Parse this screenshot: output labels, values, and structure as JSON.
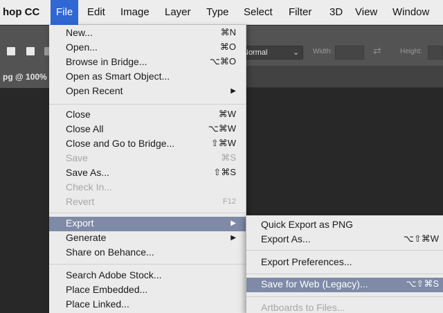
{
  "menubar": {
    "app_name": "hop CC",
    "items": [
      "File",
      "Edit",
      "Image",
      "Layer",
      "Type",
      "Select",
      "Filter",
      "3D",
      "View",
      "Window"
    ]
  },
  "options_bar": {
    "style_value": "Normal",
    "width_label": "Width:",
    "height_label": "Height:"
  },
  "document_tab": {
    "label": "pg @ 100%"
  },
  "file_menu": {
    "new": {
      "label": "New...",
      "shortcut": "⌘N"
    },
    "open": {
      "label": "Open...",
      "shortcut": "⌘O"
    },
    "browse_bridge": {
      "label": "Browse in Bridge...",
      "shortcut": "⌥⌘O"
    },
    "open_smart_object": {
      "label": "Open as Smart Object..."
    },
    "open_recent": {
      "label": "Open Recent",
      "arrow": "▶"
    },
    "close": {
      "label": "Close",
      "shortcut": "⌘W"
    },
    "close_all": {
      "label": "Close All",
      "shortcut": "⌥⌘W"
    },
    "close_go_bridge": {
      "label": "Close and Go to Bridge...",
      "shortcut": "⇧⌘W"
    },
    "save": {
      "label": "Save",
      "shortcut": "⌘S"
    },
    "save_as": {
      "label": "Save As...",
      "shortcut": "⇧⌘S"
    },
    "check_in": {
      "label": "Check In..."
    },
    "revert": {
      "label": "Revert",
      "shortcut": "F12"
    },
    "export": {
      "label": "Export",
      "arrow": "▶"
    },
    "generate": {
      "label": "Generate",
      "arrow": "▶"
    },
    "share_behance": {
      "label": "Share on Behance..."
    },
    "search_stock": {
      "label": "Search Adobe Stock..."
    },
    "place_embedded": {
      "label": "Place Embedded..."
    },
    "place_linked": {
      "label": "Place Linked..."
    }
  },
  "export_submenu": {
    "quick_export": {
      "label": "Quick Export as PNG"
    },
    "export_as": {
      "label": "Export As...",
      "shortcut": "⌥⇧⌘W"
    },
    "export_prefs": {
      "label": "Export Preferences..."
    },
    "save_for_web": {
      "label": "Save for Web (Legacy)...",
      "shortcut": "⌥⇧⌘S"
    },
    "artboards_files": {
      "label": "Artboards to Files..."
    }
  },
  "colors": {
    "menu_highlight": "#7e8aa6",
    "menubar_active": "#2f67d3",
    "menu_bg": "#ebebeb"
  }
}
